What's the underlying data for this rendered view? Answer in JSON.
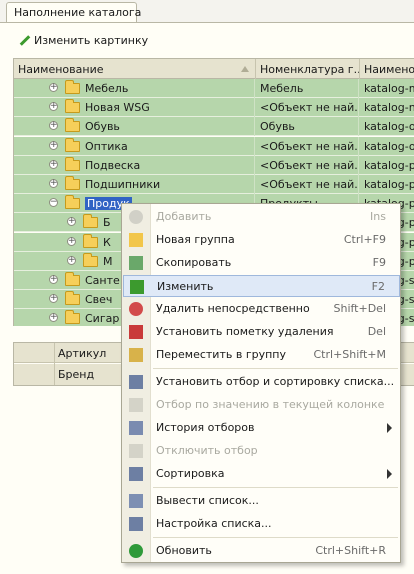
{
  "tab": {
    "title": "Наполнение каталога"
  },
  "toolbar": {
    "change_image_label": "Изменить картинку"
  },
  "grid": {
    "columns": [
      "Наименование",
      "Номенклатура г...",
      "Наименов"
    ],
    "rows": [
      {
        "name": "Мебель",
        "nomenclature": "Мебель",
        "slug": "katalog-mel"
      },
      {
        "name": "Новая WSG",
        "nomenclature": "<Объект не най...",
        "slug": "katalog-nov"
      },
      {
        "name": "Обувь",
        "nomenclature": "Обувь",
        "slug": "katalog-obu"
      },
      {
        "name": "Оптика",
        "nomenclature": "<Объект не най...",
        "slug": "katalog-opt"
      },
      {
        "name": "Подвеска",
        "nomenclature": "<Объект не най...",
        "slug": "katalog-pod"
      },
      {
        "name": "Подшипники",
        "nomenclature": "<Объект не най...",
        "slug": "katalog-pod"
      },
      {
        "name": "Продук",
        "nomenclature": "Продукты",
        "slug": "katalog-pro"
      },
      {
        "name": "Б",
        "nomenclature": "",
        "slug": "katalog-pro"
      },
      {
        "name": "К",
        "nomenclature": "",
        "slug": "katalog-pro"
      },
      {
        "name": "М",
        "nomenclature": "",
        "slug": "katalog-pro"
      },
      {
        "name": "Санте",
        "nomenclature": "",
        "slug": "katalog-san"
      },
      {
        "name": "Свеч",
        "nomenclature": "",
        "slug": "katalog-sve"
      },
      {
        "name": "Сигар",
        "nomenclature": "",
        "slug": "katalog-sig"
      }
    ]
  },
  "sub_table": {
    "col_article": "Артикул",
    "col_brand": "Бренд"
  },
  "context_menu": {
    "items": [
      {
        "label": "Добавить",
        "shortcut": "Ins",
        "disabled": true,
        "icon": "add-icon"
      },
      {
        "label": "Новая группа",
        "shortcut": "Ctrl+F9",
        "icon": "new-group-icon"
      },
      {
        "label": "Скопировать",
        "shortcut": "F9",
        "icon": "copy-icon"
      },
      {
        "label": "Изменить",
        "shortcut": "F2",
        "icon": "edit-icon",
        "highlighted": true
      },
      {
        "label": "Удалить непосредственно",
        "shortcut": "Shift+Del",
        "icon": "delete-icon"
      },
      {
        "label": "Установить пометку удаления",
        "shortcut": "Del",
        "icon": "mark-delete-icon"
      },
      {
        "label": "Переместить в группу",
        "shortcut": "Ctrl+Shift+M",
        "icon": "move-icon"
      },
      {
        "label": "Установить отбор и сортировку списка...",
        "shortcut": "",
        "icon": "filter-sort-icon"
      },
      {
        "label": "Отбор по значению в текущей колонке",
        "shortcut": "",
        "icon": "filter-value-icon",
        "disabled": true
      },
      {
        "label": "История отборов",
        "shortcut": "",
        "icon": "filter-history-icon",
        "submenu": true
      },
      {
        "label": "Отключить отбор",
        "shortcut": "",
        "icon": "filter-off-icon",
        "disabled": true
      },
      {
        "label": "Сортировка",
        "shortcut": "",
        "icon": "sort-icon",
        "submenu": true
      },
      {
        "label": "Вывести список...",
        "shortcut": "",
        "icon": "print-list-icon"
      },
      {
        "label": "Настройка списка...",
        "shortcut": "",
        "icon": "list-settings-icon"
      },
      {
        "label": "Обновить",
        "shortcut": "Ctrl+Shift+R",
        "icon": "refresh-icon"
      }
    ]
  },
  "colors": {
    "row_green": "#b6d6ab",
    "header": "#e6e3cf",
    "selection": "#3163c4",
    "menu_highlight": "#dfe9f7"
  }
}
